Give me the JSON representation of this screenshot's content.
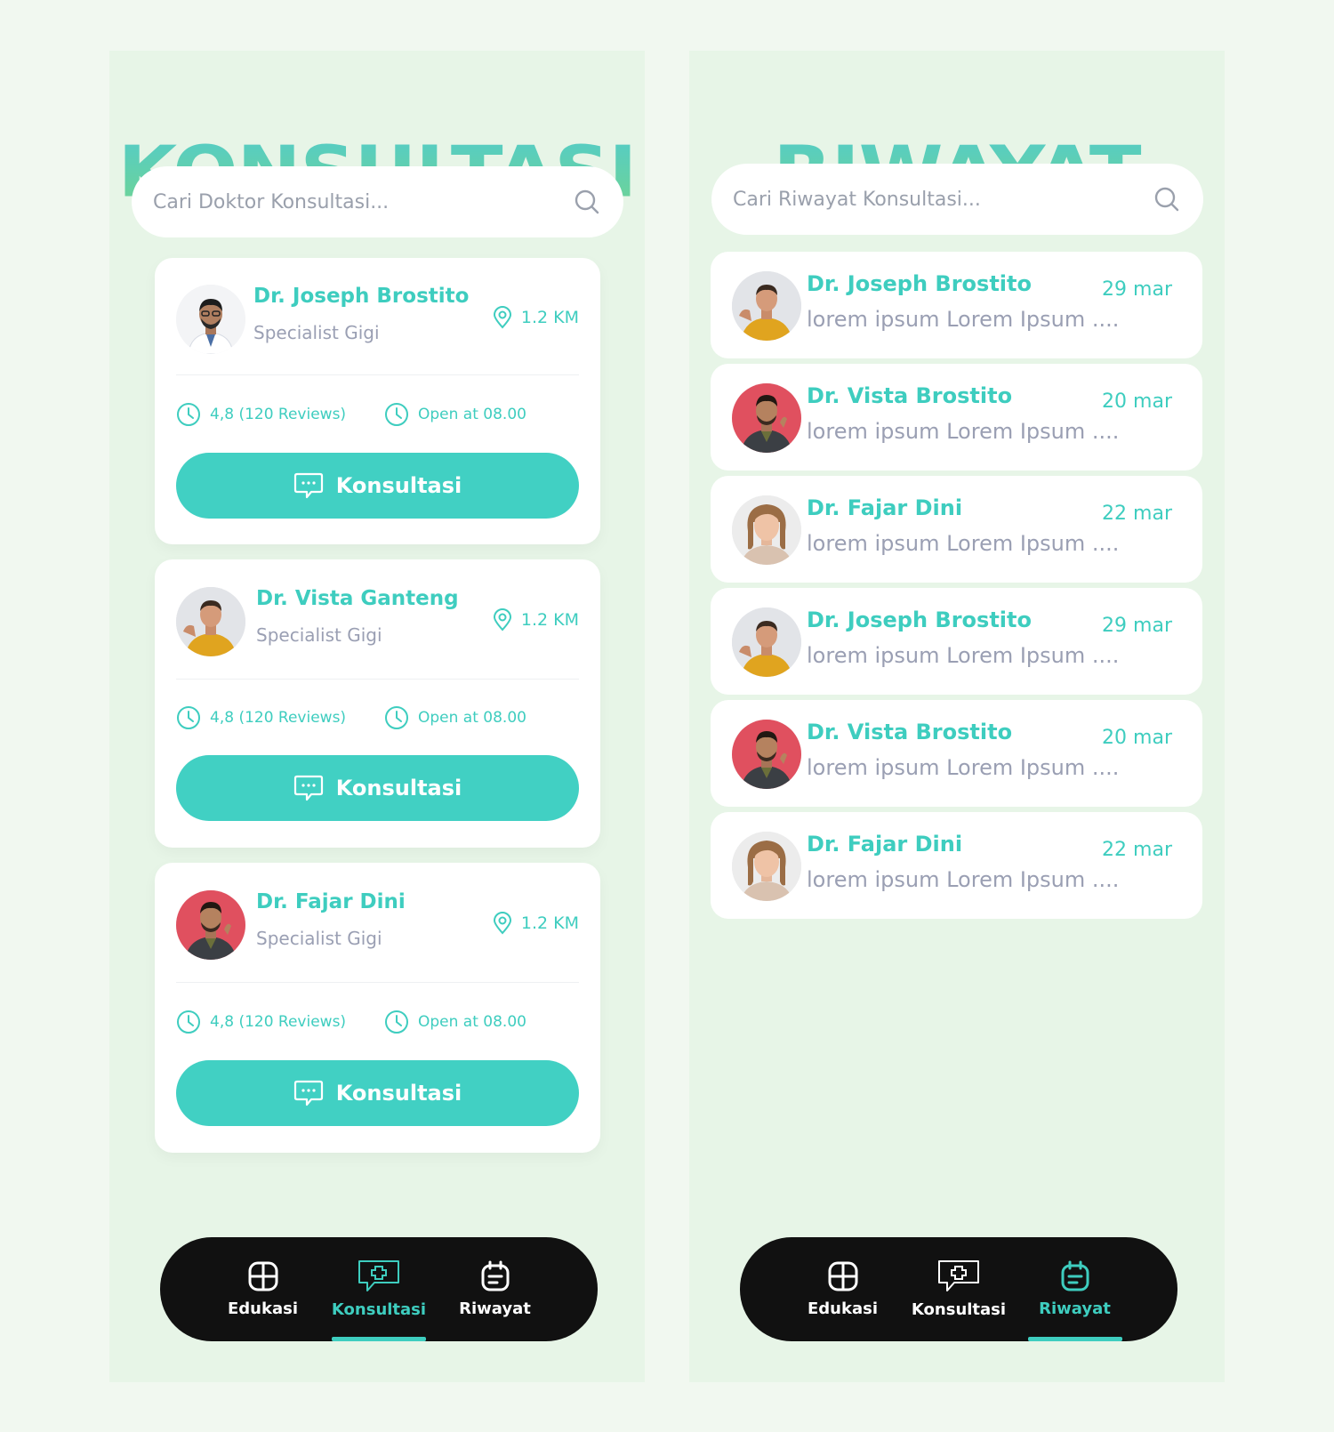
{
  "konsultasi": {
    "title": "KONSULTASI",
    "search_placeholder": "Cari Doktor Konsultasi...",
    "doctors": [
      {
        "name": "Dr. Joseph Brostito",
        "specialty": "Specialist Gigi",
        "distance": "1.2 KM",
        "rating": "4,8 (120 Reviews)",
        "hours": "Open at 08.00",
        "button_label": "Konsultasi",
        "avatar": "doctor-coat"
      },
      {
        "name": "Dr. Vista Ganteng",
        "specialty": "Specialist Gigi",
        "distance": "1.2 KM",
        "rating": "4,8 (120 Reviews)",
        "hours": "Open at 08.00",
        "button_label": "Konsultasi",
        "avatar": "man-yellow"
      },
      {
        "name": "Dr. Fajar Dini",
        "specialty": "Specialist Gigi",
        "distance": "1.2 KM",
        "rating": "4,8 (120 Reviews)",
        "hours": "Open at 08.00",
        "button_label": "Konsultasi",
        "avatar": "man-red"
      }
    ],
    "nav": [
      {
        "label": "Edukasi",
        "icon": "grid-icon",
        "active": false
      },
      {
        "label": "Konsultasi",
        "icon": "chat-plus-icon",
        "active": true
      },
      {
        "label": "Riwayat",
        "icon": "calendar-list-icon",
        "active": false
      }
    ]
  },
  "riwayat": {
    "title": "RIWAYAT",
    "search_placeholder": "Cari Riwayat Konsultasi...",
    "history": [
      {
        "name": "Dr. Joseph Brostito",
        "date": "29 mar",
        "preview": "lorem ipsum Lorem Ipsum ....",
        "avatar": "man-yellow"
      },
      {
        "name": "Dr. Vista Brostito",
        "date": "20 mar",
        "preview": "lorem ipsum Lorem Ipsum ....",
        "avatar": "man-red"
      },
      {
        "name": "Dr. Fajar Dini",
        "date": "22 mar",
        "preview": "lorem ipsum Lorem Ipsum ....",
        "avatar": "woman"
      },
      {
        "name": "Dr. Joseph Brostito",
        "date": "29 mar",
        "preview": "lorem ipsum Lorem Ipsum ....",
        "avatar": "man-yellow"
      },
      {
        "name": "Dr. Vista Brostito",
        "date": "20 mar",
        "preview": "lorem ipsum Lorem Ipsum ....",
        "avatar": "man-red"
      },
      {
        "name": "Dr. Fajar Dini",
        "date": "22 mar",
        "preview": "lorem ipsum Lorem Ipsum ....",
        "avatar": "woman"
      }
    ],
    "nav": [
      {
        "label": "Edukasi",
        "icon": "grid-icon",
        "active": false
      },
      {
        "label": "Konsultasi",
        "icon": "chat-plus-icon",
        "active": false
      },
      {
        "label": "Riwayat",
        "icon": "calendar-list-icon",
        "active": true
      }
    ]
  },
  "colors": {
    "accent": "#41d0c3",
    "background": "#e7f5e7",
    "nav": "#111111",
    "muted": "#9a9fb3"
  }
}
